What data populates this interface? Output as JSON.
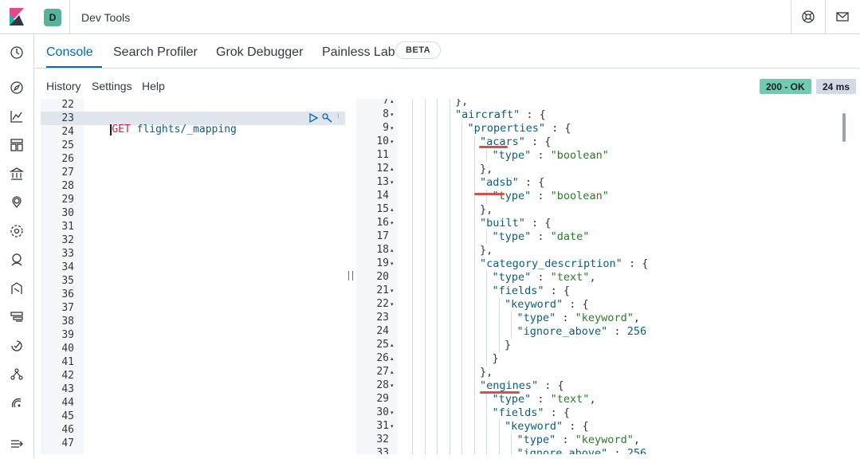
{
  "header": {
    "app_title": "Dev Tools",
    "avatar_letter": "D",
    "help_icon": "help-icon",
    "mail_icon": "newsfeed-icon",
    "brand_color": "#006bb8"
  },
  "sidenav": {
    "icons": [
      "clock-icon",
      "compass-icon",
      "chart-icon",
      "dashboard-icon",
      "bank-icon",
      "map-pin-icon",
      "gear-cluster-icon",
      "user-check-icon",
      "machine-learning-icon",
      "stack-icon",
      "apm-icon",
      "graph-icon",
      "signal-icon",
      "collapse-icon"
    ]
  },
  "tabs": [
    {
      "label": "Console",
      "active": true
    },
    {
      "label": "Search Profiler",
      "active": false
    },
    {
      "label": "Grok Debugger",
      "active": false
    },
    {
      "label": "Painless Lab",
      "active": false
    }
  ],
  "beta_badge": "BETA",
  "menu": {
    "history": "History",
    "settings": "Settings",
    "help": "Help"
  },
  "status": {
    "code": "200 - OK",
    "time": "24 ms"
  },
  "editor": {
    "line_numbers": [
      "22",
      "23",
      "24",
      "25",
      "26",
      "27",
      "28",
      "29",
      "30",
      "31",
      "32",
      "33",
      "34",
      "35",
      "36",
      "37",
      "38",
      "39",
      "40",
      "41",
      "42",
      "43",
      "44",
      "45",
      "46",
      "47"
    ],
    "method": "GET",
    "path": "flights/_mapping"
  },
  "output": {
    "lines": [
      {
        "n": "7",
        "fold": "▴",
        "depth": 4,
        "parts": [
          [
            "p",
            "},"
          ]
        ]
      },
      {
        "n": "8",
        "fold": "▾",
        "depth": 4,
        "parts": [
          [
            "k",
            "\"aircraft\""
          ],
          [
            "p",
            " : {"
          ]
        ]
      },
      {
        "n": "9",
        "fold": "▾",
        "depth": 5,
        "parts": [
          [
            "k",
            "\"properties\""
          ],
          [
            "p",
            " : {"
          ]
        ]
      },
      {
        "n": "10",
        "fold": "▾",
        "depth": 6,
        "parts": [
          [
            "k",
            "\"acars\""
          ],
          [
            "p",
            " : {"
          ]
        ]
      },
      {
        "n": "11",
        "fold": "",
        "depth": 7,
        "parts": [
          [
            "k",
            "\"type\""
          ],
          [
            "p",
            " : "
          ],
          [
            "s",
            "\"boolean\""
          ]
        ]
      },
      {
        "n": "12",
        "fold": "▴",
        "depth": 6,
        "parts": [
          [
            "p",
            "},"
          ]
        ]
      },
      {
        "n": "13",
        "fold": "▾",
        "depth": 6,
        "parts": [
          [
            "k",
            "\"adsb\""
          ],
          [
            "p",
            " : {"
          ]
        ]
      },
      {
        "n": "14",
        "fold": "",
        "depth": 7,
        "parts": [
          [
            "k",
            "\"type\""
          ],
          [
            "p",
            " : "
          ],
          [
            "s",
            "\"boolean\""
          ]
        ]
      },
      {
        "n": "15",
        "fold": "▴",
        "depth": 6,
        "parts": [
          [
            "p",
            "},"
          ]
        ]
      },
      {
        "n": "16",
        "fold": "▾",
        "depth": 6,
        "parts": [
          [
            "k",
            "\"built\""
          ],
          [
            "p",
            " : {"
          ]
        ]
      },
      {
        "n": "17",
        "fold": "",
        "depth": 7,
        "parts": [
          [
            "k",
            "\"type\""
          ],
          [
            "p",
            " : "
          ],
          [
            "s",
            "\"date\""
          ]
        ]
      },
      {
        "n": "18",
        "fold": "▴",
        "depth": 6,
        "parts": [
          [
            "p",
            "},"
          ]
        ]
      },
      {
        "n": "19",
        "fold": "▾",
        "depth": 6,
        "parts": [
          [
            "k",
            "\"category_description\""
          ],
          [
            "p",
            " : {"
          ]
        ]
      },
      {
        "n": "20",
        "fold": "",
        "depth": 7,
        "parts": [
          [
            "k",
            "\"type\""
          ],
          [
            "p",
            " : "
          ],
          [
            "s",
            "\"text\""
          ],
          [
            "p",
            ","
          ]
        ]
      },
      {
        "n": "21",
        "fold": "▾",
        "depth": 7,
        "parts": [
          [
            "k",
            "\"fields\""
          ],
          [
            "p",
            " : {"
          ]
        ]
      },
      {
        "n": "22",
        "fold": "▾",
        "depth": 8,
        "parts": [
          [
            "k",
            "\"keyword\""
          ],
          [
            "p",
            " : {"
          ]
        ]
      },
      {
        "n": "23",
        "fold": "",
        "depth": 9,
        "parts": [
          [
            "k",
            "\"type\""
          ],
          [
            "p",
            " : "
          ],
          [
            "s",
            "\"keyword\""
          ],
          [
            "p",
            ","
          ]
        ]
      },
      {
        "n": "24",
        "fold": "",
        "depth": 9,
        "parts": [
          [
            "k",
            "\"ignore_above\""
          ],
          [
            "p",
            " : "
          ],
          [
            "n",
            "256"
          ]
        ]
      },
      {
        "n": "25",
        "fold": "▴",
        "depth": 8,
        "parts": [
          [
            "p",
            "}"
          ]
        ]
      },
      {
        "n": "26",
        "fold": "▴",
        "depth": 7,
        "parts": [
          [
            "p",
            "}"
          ]
        ]
      },
      {
        "n": "27",
        "fold": "▴",
        "depth": 6,
        "parts": [
          [
            "p",
            "},"
          ]
        ]
      },
      {
        "n": "28",
        "fold": "▾",
        "depth": 6,
        "parts": [
          [
            "k",
            "\"engines\""
          ],
          [
            "p",
            " : {"
          ]
        ]
      },
      {
        "n": "29",
        "fold": "",
        "depth": 7,
        "parts": [
          [
            "k",
            "\"type\""
          ],
          [
            "p",
            " : "
          ],
          [
            "s",
            "\"text\""
          ],
          [
            "p",
            ","
          ]
        ]
      },
      {
        "n": "30",
        "fold": "▾",
        "depth": 7,
        "parts": [
          [
            "k",
            "\"fields\""
          ],
          [
            "p",
            " : {"
          ]
        ]
      },
      {
        "n": "31",
        "fold": "▾",
        "depth": 8,
        "parts": [
          [
            "k",
            "\"keyword\""
          ],
          [
            "p",
            " : {"
          ]
        ]
      },
      {
        "n": "32",
        "fold": "",
        "depth": 9,
        "parts": [
          [
            "k",
            "\"type\""
          ],
          [
            "p",
            " : "
          ],
          [
            "s",
            "\"keyword\""
          ],
          [
            "p",
            ","
          ]
        ]
      },
      {
        "n": "33",
        "fold": "",
        "depth": 9,
        "parts": [
          [
            "k",
            "\"ignore_above\""
          ],
          [
            "p",
            " : "
          ],
          [
            "n",
            "256"
          ]
        ]
      }
    ]
  }
}
